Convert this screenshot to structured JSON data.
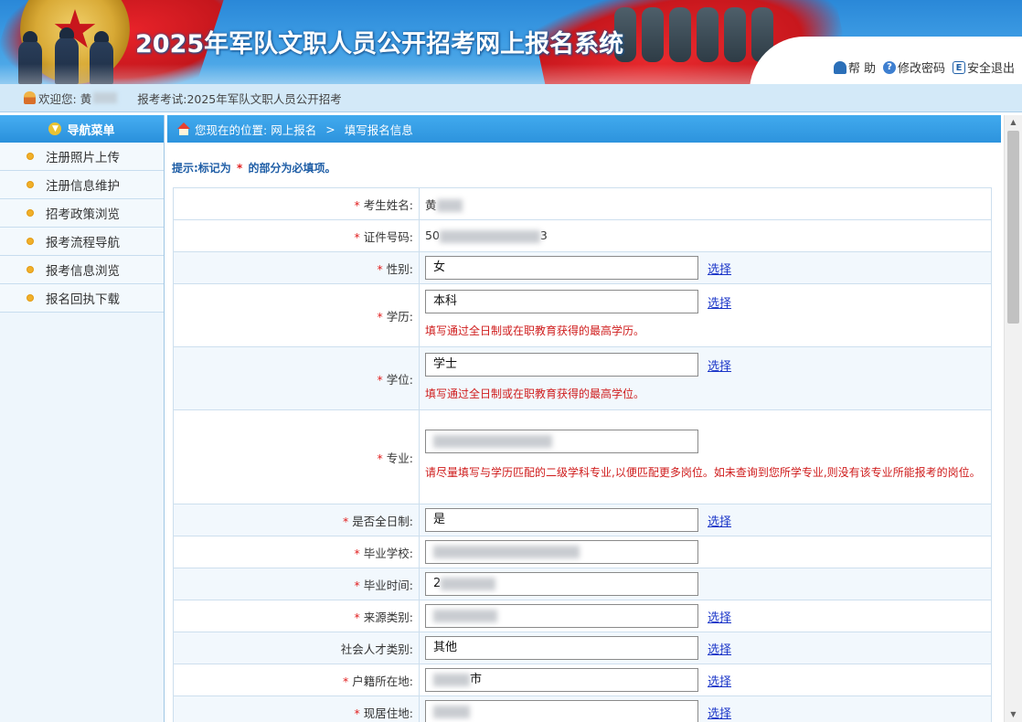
{
  "header": {
    "title": "2025年军队文职人员公开招考网上报名系统",
    "help_label": "帮 助",
    "change_password_label": "修改密码",
    "logout_label": "安全退出"
  },
  "welcome": {
    "greeting": "欢迎您:",
    "user_initial": "黄",
    "exam_label": "报考考试:",
    "exam_name": "2025年军队文职人员公开招考"
  },
  "sidebar": {
    "title": "导航菜单",
    "items": [
      {
        "label": "注册照片上传"
      },
      {
        "label": "注册信息维护"
      },
      {
        "label": "招考政策浏览"
      },
      {
        "label": "报考流程导航"
      },
      {
        "label": "报考信息浏览"
      },
      {
        "label": "报名回执下载"
      }
    ]
  },
  "breadcrumb": {
    "prefix": "您现在的位置:",
    "level1": "网上报名",
    "separator": ">",
    "level2": "填写报名信息"
  },
  "hint": {
    "before": "提示:标记为",
    "star": "*",
    "after": "的部分为必填项。"
  },
  "form": {
    "required_mark": "*",
    "select_label": "选择",
    "name": {
      "label": "考生姓名:",
      "value_prefix": "黄"
    },
    "id_number": {
      "label": "证件号码:",
      "value_start": "50",
      "value_end": "3"
    },
    "gender": {
      "label": "性别:",
      "value": "女"
    },
    "education": {
      "label": "学历:",
      "value": "本科",
      "note": "填写通过全日制或在职教育获得的最高学历。"
    },
    "degree": {
      "label": "学位:",
      "value": "学士",
      "note": "填写通过全日制或在职教育获得的最高学位。"
    },
    "major": {
      "label": "专业:",
      "note": "请尽量填写与学历匹配的二级学科专业,以便匹配更多岗位。如未查询到您所学专业,则没有该专业所能报考的岗位。"
    },
    "fulltime": {
      "label": "是否全日制:",
      "value": "是"
    },
    "school": {
      "label": "毕业学校:"
    },
    "grad_time": {
      "label": "毕业时间:",
      "value_prefix": "2"
    },
    "source_type": {
      "label": "来源类别:"
    },
    "talent_type": {
      "label": "社会人才类别:",
      "value": "其他"
    },
    "household": {
      "label": "户籍所在地:",
      "value_suffix": "市"
    },
    "residence": {
      "label": "现居住地:"
    }
  }
}
